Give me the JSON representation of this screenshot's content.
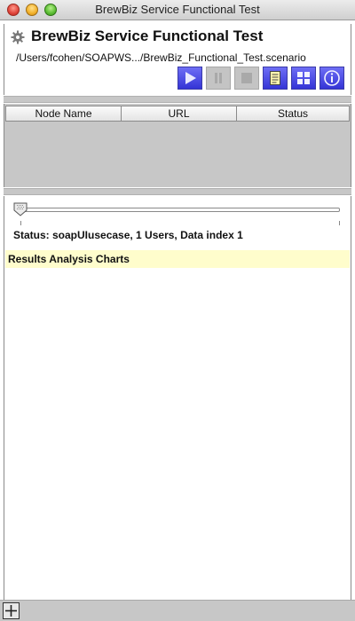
{
  "window": {
    "title": "BrewBiz Service Functional Test"
  },
  "header": {
    "title": "BrewBiz Service Functional Test",
    "path": "/Users/fcohen/SOAPWS.../BrewBiz_Functional_Test.scenario",
    "icon": "gear-icon"
  },
  "toolbar": {
    "buttons": [
      {
        "name": "play-button",
        "icon": "play-icon",
        "enabled": true
      },
      {
        "name": "pause-button",
        "icon": "pause-icon",
        "enabled": false
      },
      {
        "name": "stop-button",
        "icon": "stop-icon",
        "enabled": false
      },
      {
        "name": "notes-button",
        "icon": "document-icon",
        "enabled": true
      },
      {
        "name": "grid-button",
        "icon": "grid-icon",
        "enabled": true
      },
      {
        "name": "info-button",
        "icon": "info-icon",
        "enabled": true
      }
    ]
  },
  "table": {
    "columns": [
      "Node Name",
      "URL",
      "Status"
    ],
    "rows": []
  },
  "progress": {
    "position": 0
  },
  "status": {
    "text": "Status: soapUIusecase, 1 Users, Data index 1"
  },
  "results": {
    "label": "Results Analysis Charts"
  },
  "colors": {
    "accent": "#3c3cdc",
    "results_bg": "#fffdcc",
    "panel_gray": "#c7c7c7"
  }
}
